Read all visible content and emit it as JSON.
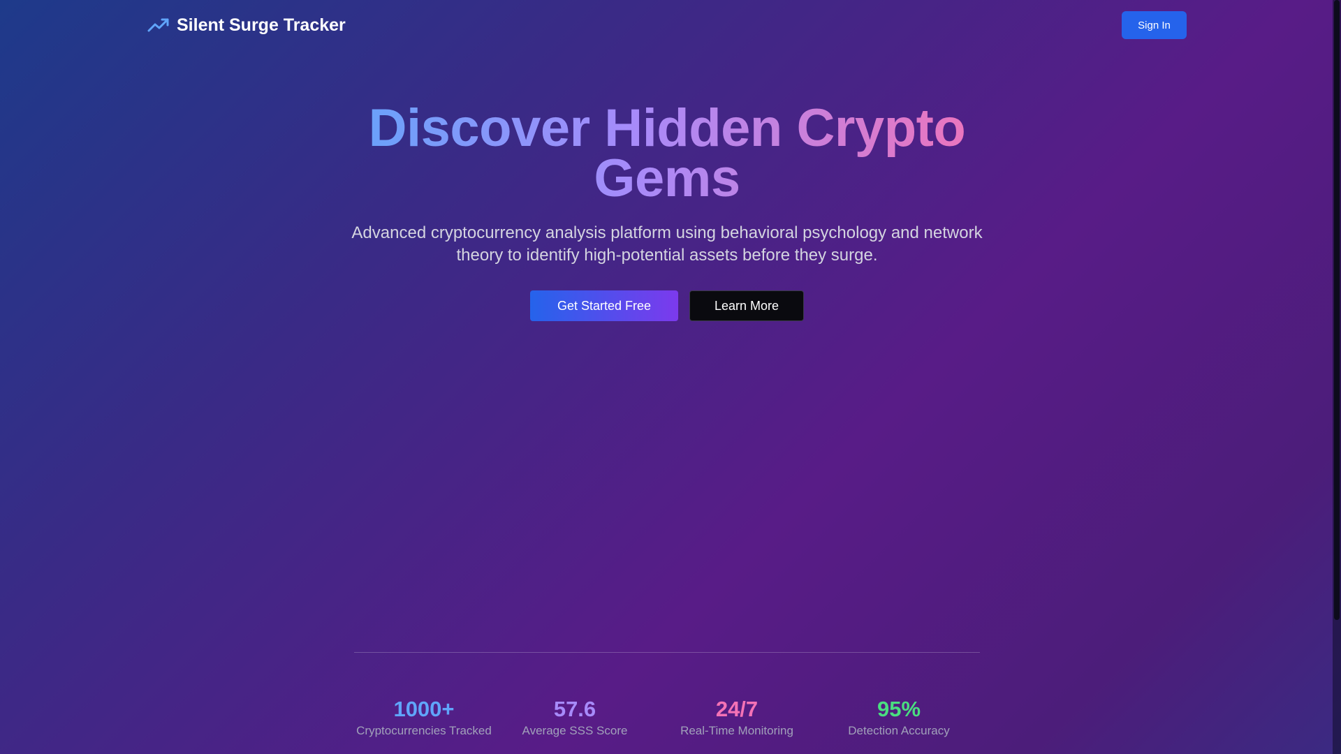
{
  "header": {
    "brand_name": "Silent Surge Tracker",
    "brand_icon": "trending-up-icon",
    "sign_in_label": "Sign In"
  },
  "hero": {
    "title": "Discover Hidden Crypto Gems",
    "subtitle": "Advanced cryptocurrency analysis platform using behavioral psychology and network theory to identify high-potential assets before they surge.",
    "primary_cta": "Get Started Free",
    "secondary_cta": "Learn More"
  },
  "stats": [
    {
      "value": "1000+",
      "label": "Cryptocurrencies Tracked",
      "color": "#60a5fa"
    },
    {
      "value": "57.6",
      "label": "Average SSS Score",
      "color": "#a78bfa"
    },
    {
      "value": "24/7",
      "label": "Real-Time Monitoring",
      "color": "#f472b6"
    },
    {
      "value": "95%",
      "label": "Detection Accuracy",
      "color": "#4ade80"
    }
  ],
  "colors": {
    "accent_blue": "#2563eb",
    "accent_purple": "#7c3aed",
    "icon_blue": "#60a5fa"
  }
}
